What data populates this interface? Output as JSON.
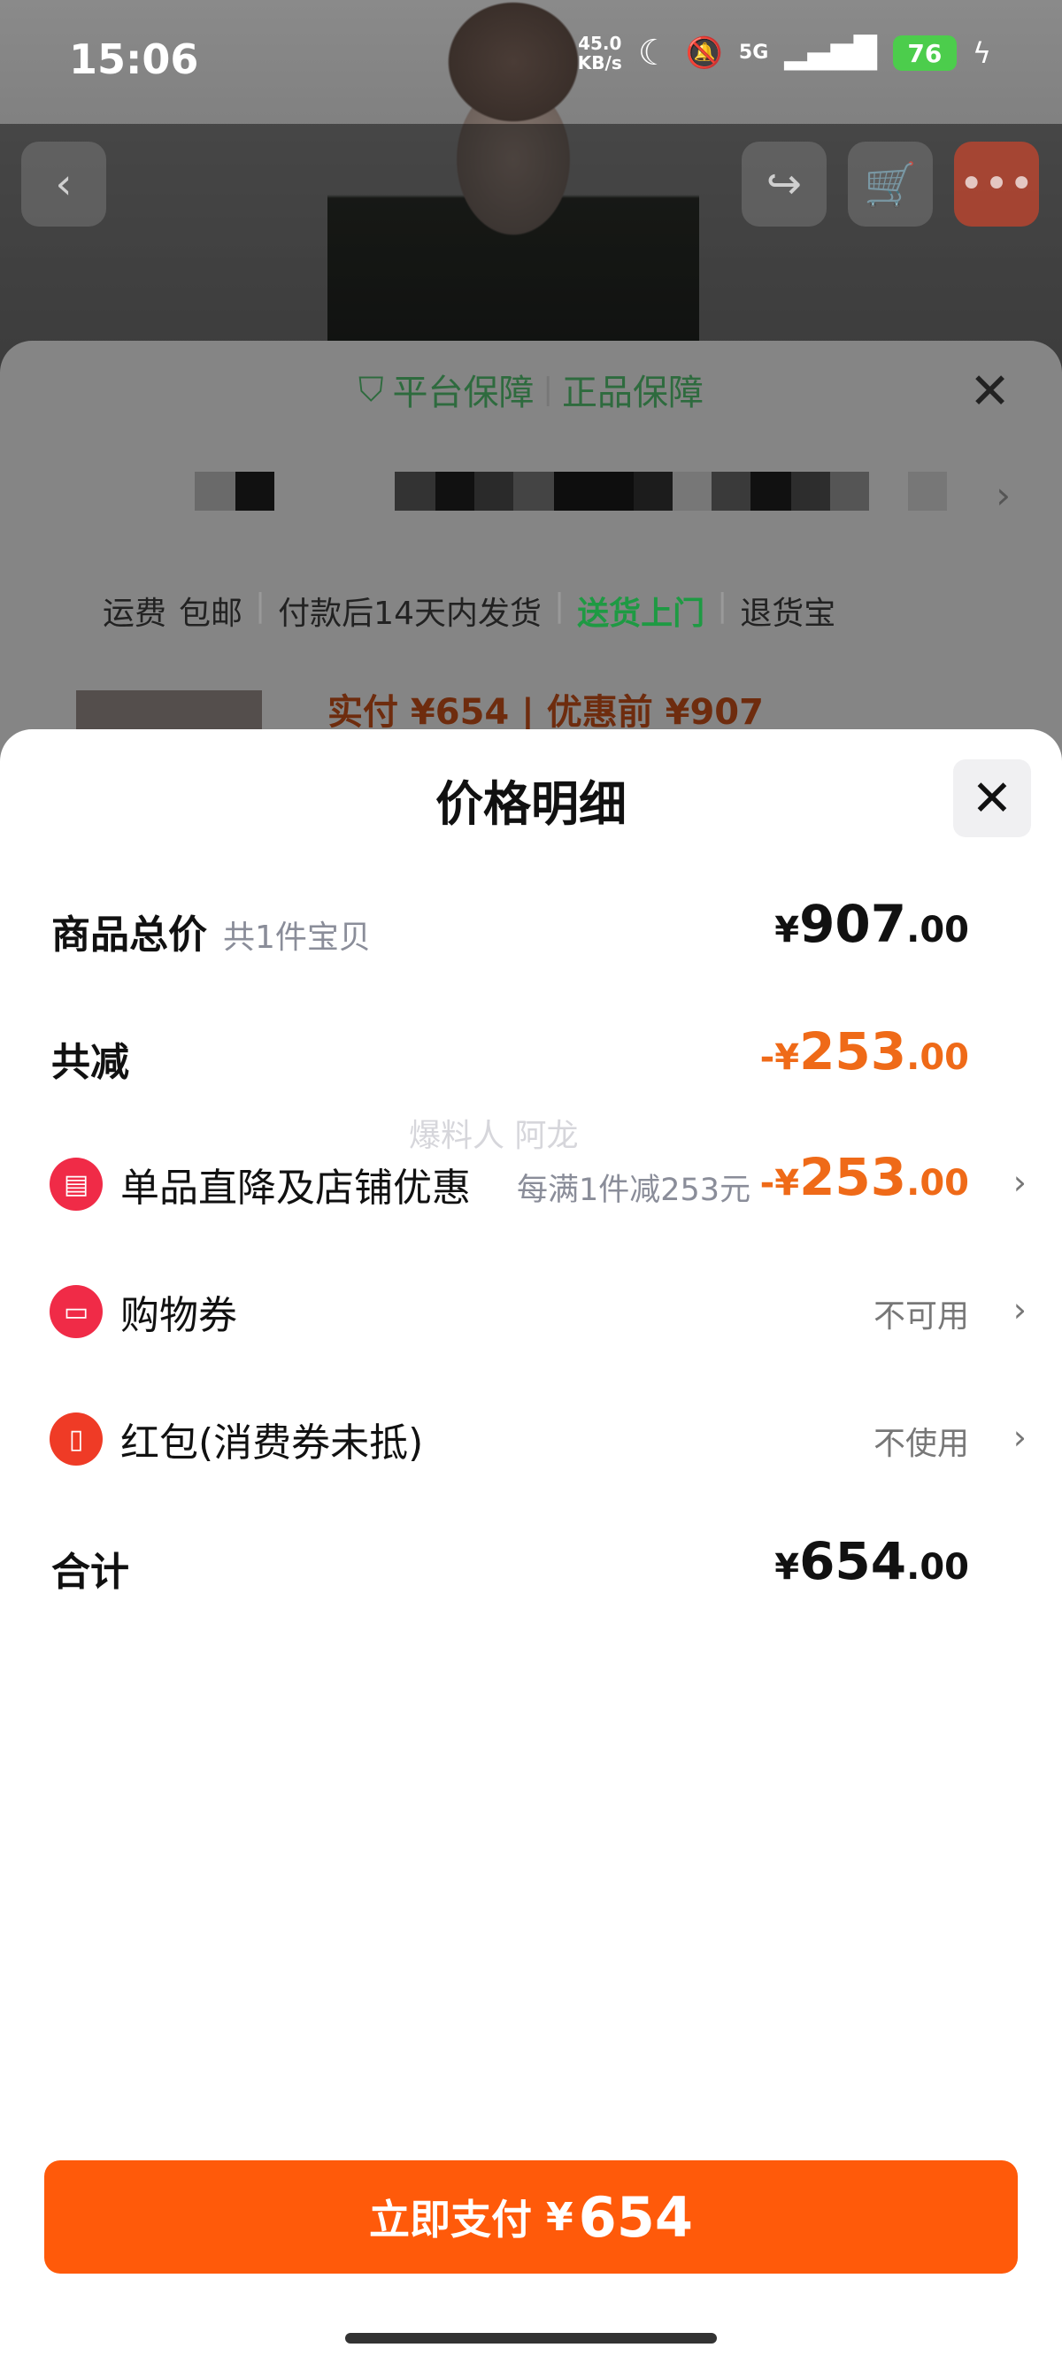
{
  "status_bar": {
    "time": "15:06",
    "net_speed_value": "45.0",
    "net_speed_unit": "KB/s",
    "network": "5G",
    "battery": "76"
  },
  "background_page": {
    "guarantee_left": "平台保障",
    "guarantee_right": "正品保障",
    "shipping": {
      "fee_label": "运费",
      "fee_value": "包邮",
      "ship_time": "付款后14天内发货",
      "delivery": "送货上门",
      "returns": "退货宝"
    },
    "price_peek": "实付 ¥654 | 优惠前 ¥907"
  },
  "sheet": {
    "title": "价格明细",
    "rows": {
      "total": {
        "label": "商品总价",
        "sub": "共1件宝贝",
        "currency": "¥",
        "int": "907",
        "dec": ".00"
      },
      "reduction": {
        "label": "共减",
        "currency": "-¥",
        "int": "253",
        "dec": ".00"
      },
      "store_discount": {
        "label": "单品直降及店铺优惠",
        "rule": "每满1件减253元",
        "currency": "-¥",
        "int": "253",
        "dec": ".00"
      },
      "coupon": {
        "label": "购物券",
        "status": "不可用"
      },
      "red_packet": {
        "label": "红包(消费券未抵)",
        "status": "不使用"
      },
      "sum": {
        "label": "合计",
        "currency": "¥",
        "int": "654",
        "dec": ".00"
      }
    },
    "watermark": "爆料人 阿龙",
    "pay_button": {
      "label": "立即支付",
      "currency": "¥",
      "amount": "654"
    }
  },
  "colors": {
    "accent_orange": "#ff5a0a",
    "discount_text": "#ef6a18",
    "guarantee_green": "#2e6b3e",
    "delivery_green": "#1e9a43",
    "icon_red": "#f02b47"
  }
}
